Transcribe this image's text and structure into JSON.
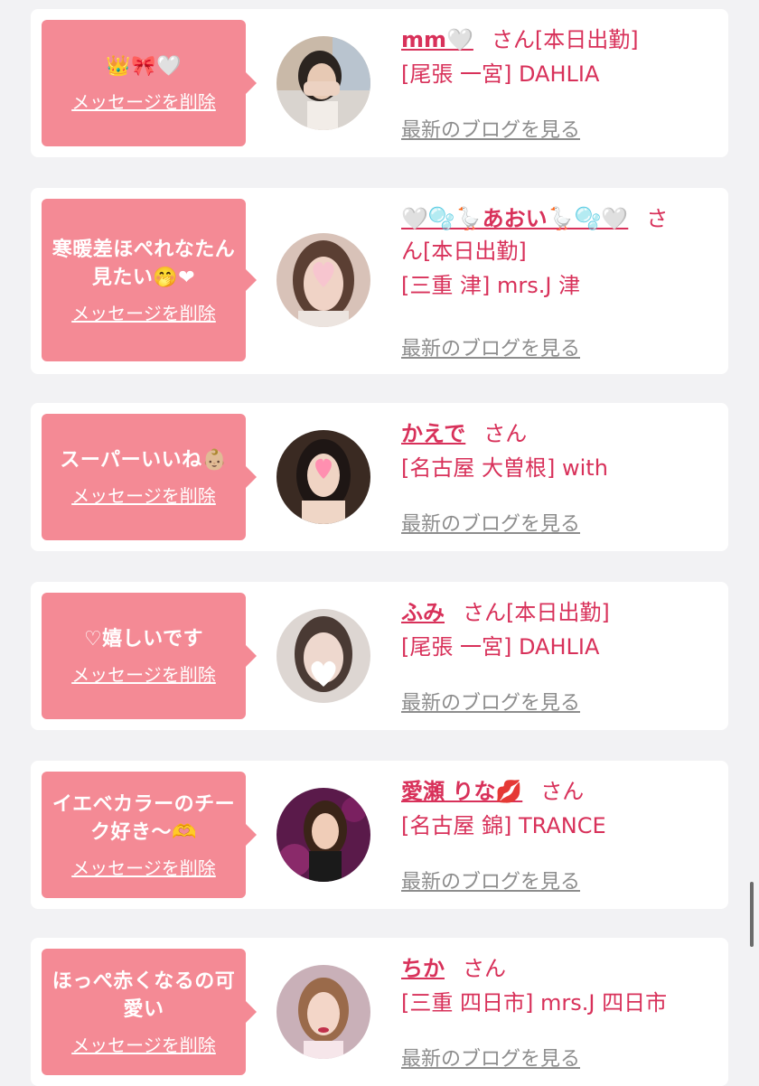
{
  "items": [
    {
      "message": "👑🎀🤍",
      "delete": "メッセージを削除",
      "name": "mm🤍",
      "san": "さん",
      "status": "[本日出勤]",
      "shop": "[尾張 一宮] DAHLIA",
      "blog": "最新のブログを見る"
    },
    {
      "message": "寒暖差ほぺれなたん見たい🤭❤",
      "delete": "メッセージを削除",
      "name": "🤍🫧🪿あおい🪿🫧🤍",
      "san": "さ",
      "san2": "ん",
      "status": "[本日出勤]",
      "shop": "[三重 津] mrs.J 津",
      "blog": "最新のブログを見る"
    },
    {
      "message": "スーパーいいね👶🏼",
      "delete": "メッセージを削除",
      "name": "かえで",
      "san": "さん",
      "status": "",
      "shop": "[名古屋 大曽根] with",
      "blog": "最新のブログを見る"
    },
    {
      "message": "♡嬉しいです",
      "delete": "メッセージを削除",
      "name": "ふみ",
      "san": "さん",
      "status": "[本日出勤]",
      "shop": "[尾張 一宮] DAHLIA",
      "blog": "最新のブログを見る"
    },
    {
      "message": "イエベカラーのチーク好き～🫶",
      "delete": "メッセージを削除",
      "name": "愛瀬 りな💋",
      "san": "さん",
      "status": "",
      "shop": "[名古屋 錦] TRANCE",
      "blog": "最新のブログを見る"
    },
    {
      "message": "ほっぺ赤くなるの可愛い",
      "delete": "メッセージを削除",
      "name": "ちか",
      "san": "さん",
      "status": "",
      "shop": "[三重 四日市] mrs.J 四日市",
      "blog": "最新のブログを見る"
    }
  ],
  "colors": {
    "accent": "#d8315a",
    "bubble": "#f48a95",
    "link_gray": "#8d8d8d",
    "background": "#f2f2f4"
  }
}
